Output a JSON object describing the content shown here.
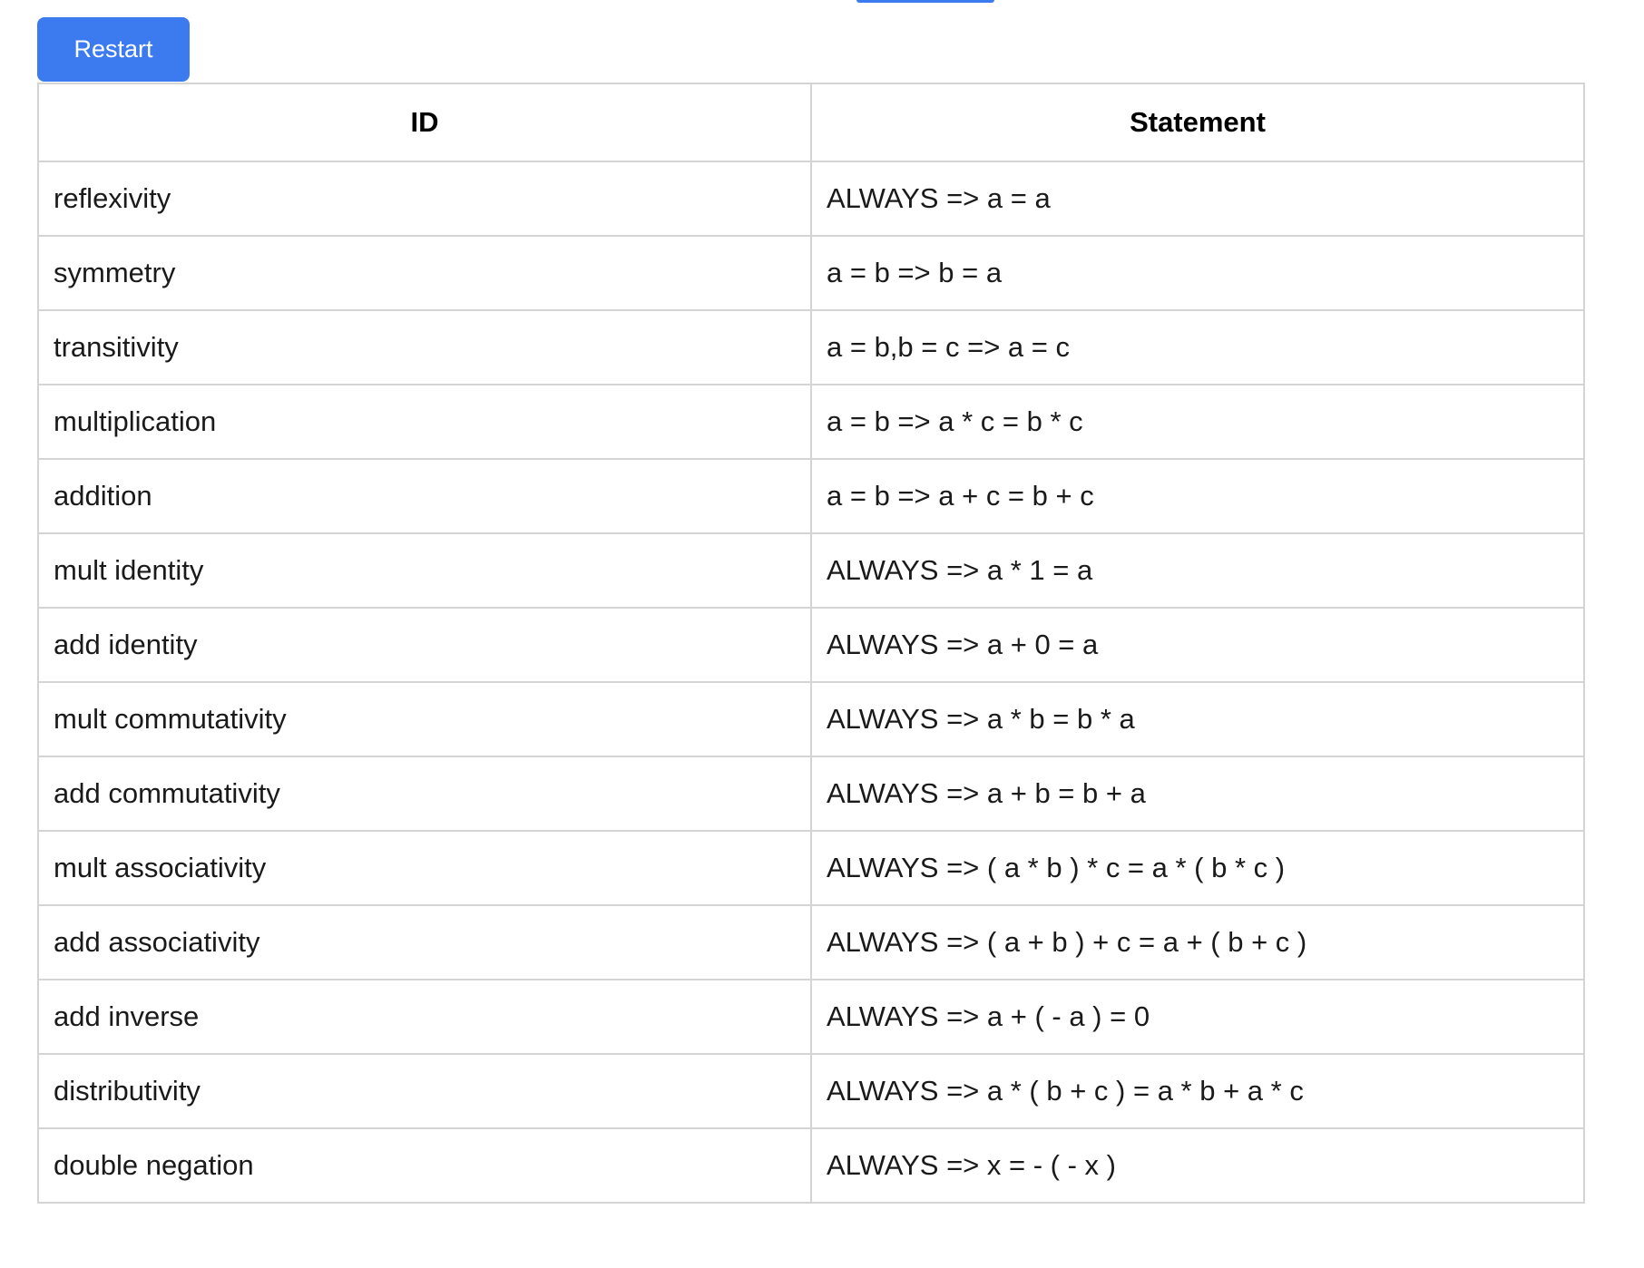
{
  "toolbar": {
    "restart_label": "Restart"
  },
  "colors": {
    "accent": "#3b7bef",
    "border": "#d4d4d4"
  },
  "table": {
    "headers": {
      "id": "ID",
      "statement": "Statement"
    },
    "rows": [
      {
        "id": "reflexivity",
        "statement": "ALWAYS => a = a"
      },
      {
        "id": "symmetry",
        "statement": "a = b => b = a"
      },
      {
        "id": "transitivity",
        "statement": "a = b,b = c => a = c"
      },
      {
        "id": "multiplication",
        "statement": "a = b => a * c = b * c"
      },
      {
        "id": "addition",
        "statement": "a = b => a + c = b + c"
      },
      {
        "id": "mult identity",
        "statement": "ALWAYS => a * 1 = a"
      },
      {
        "id": "add identity",
        "statement": "ALWAYS => a + 0 = a"
      },
      {
        "id": "mult commutativity",
        "statement": "ALWAYS => a * b = b * a"
      },
      {
        "id": "add commutativity",
        "statement": "ALWAYS => a + b = b + a"
      },
      {
        "id": "mult associativity",
        "statement": "ALWAYS => ( a * b ) * c = a * ( b * c )"
      },
      {
        "id": "add associativity",
        "statement": "ALWAYS => ( a + b ) + c = a + ( b + c )"
      },
      {
        "id": "add inverse",
        "statement": "ALWAYS => a + ( - a ) = 0"
      },
      {
        "id": "distributivity",
        "statement": "ALWAYS => a * ( b + c ) = a * b + a * c"
      },
      {
        "id": "double negation",
        "statement": "ALWAYS => x = - ( - x )"
      }
    ]
  }
}
